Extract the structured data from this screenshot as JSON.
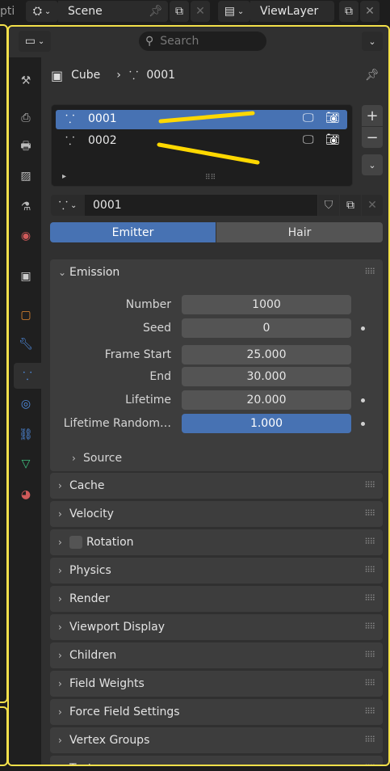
{
  "topbar": {
    "partial_left": "pti",
    "scene_name": "Scene",
    "view_layer_name": "ViewLayer"
  },
  "header": {
    "search_placeholder": "Search"
  },
  "breadcrumb": {
    "object": "Cube",
    "particle_system": "0001"
  },
  "particle_list": {
    "items": [
      {
        "name": "0001",
        "selected": true
      },
      {
        "name": "0002",
        "selected": false
      }
    ]
  },
  "settings": {
    "datablock_name": "0001"
  },
  "type_tabs": {
    "emitter": "Emitter",
    "hair": "Hair",
    "active": "Emitter"
  },
  "emission": {
    "title": "Emission",
    "fields": [
      {
        "label": "Number",
        "value": "1000",
        "dot": false
      },
      {
        "label": "Seed",
        "value": "0",
        "dot": true
      },
      {
        "label": "Frame Start",
        "value": "25.000",
        "dot": false
      },
      {
        "label": "End",
        "value": "30.000",
        "dot": false
      },
      {
        "label": "Lifetime",
        "value": "20.000",
        "dot": true
      },
      {
        "label": "Lifetime Random…",
        "value": "1.000",
        "dot": true
      }
    ],
    "source_label": "Source"
  },
  "panels": [
    "Cache",
    "Velocity",
    "Rotation",
    "Physics",
    "Render",
    "Viewport Display",
    "Children",
    "Field Weights",
    "Force Field Settings",
    "Vertex Groups",
    "Textures"
  ],
  "colors": {
    "accent_blue": "#4772b3",
    "highlight_yellow": "#f3e04a",
    "annotation_yellow": "#ffd800"
  }
}
